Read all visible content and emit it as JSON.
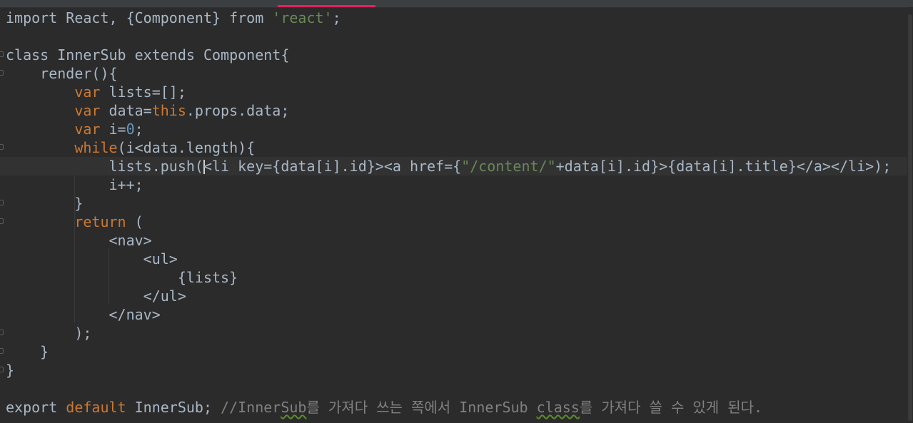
{
  "editor": {
    "language": "javascript-jsx",
    "colors": {
      "background": "#2b2b2b",
      "default_text": "#a9b7c6",
      "keyword": "#cc7832",
      "string": "#6a8759",
      "number": "#6897bb",
      "comment": "#808080",
      "active_tab_indicator": "#e0245e",
      "current_line": "#323232"
    },
    "lines": [
      {
        "tokens": [
          [
            "t",
            "import React, {Component} from "
          ],
          [
            "str",
            "'react'"
          ],
          [
            "t",
            ";"
          ]
        ]
      },
      {
        "tokens": []
      },
      {
        "tokens": [
          [
            "t",
            "class InnerSub extends Component{"
          ]
        ]
      },
      {
        "tokens": [
          [
            "t",
            "    render(){"
          ]
        ]
      },
      {
        "tokens": [
          [
            "t",
            "        "
          ],
          [
            "kw",
            "var"
          ],
          [
            "t",
            " lists=[];"
          ]
        ]
      },
      {
        "tokens": [
          [
            "t",
            "        "
          ],
          [
            "kw",
            "var"
          ],
          [
            "t",
            " data="
          ],
          [
            "kw",
            "this"
          ],
          [
            "t",
            ".props.data;"
          ]
        ]
      },
      {
        "tokens": [
          [
            "t",
            "        "
          ],
          [
            "kw",
            "var"
          ],
          [
            "t",
            " i="
          ],
          [
            "num",
            "0"
          ],
          [
            "t",
            ";"
          ]
        ]
      },
      {
        "tokens": [
          [
            "t",
            "        "
          ],
          [
            "kw",
            "while"
          ],
          [
            "t",
            "(i<data.length){"
          ]
        ]
      },
      {
        "tokens": [
          [
            "t",
            "            lists.push("
          ],
          [
            "caret",
            ""
          ],
          [
            "t",
            "<li key={data[i].id}><a href={"
          ],
          [
            "str",
            "\"/content/\""
          ],
          [
            "t",
            "+data[i].id}>{data[i].title}</a></li>);"
          ]
        ]
      },
      {
        "tokens": [
          [
            "t",
            "            i++;"
          ]
        ]
      },
      {
        "tokens": [
          [
            "t",
            "        }"
          ]
        ]
      },
      {
        "tokens": [
          [
            "t",
            "        "
          ],
          [
            "kw",
            "return"
          ],
          [
            "t",
            " ("
          ]
        ]
      },
      {
        "tokens": [
          [
            "t",
            "            <nav>"
          ]
        ]
      },
      {
        "tokens": [
          [
            "t",
            "                <ul>"
          ]
        ]
      },
      {
        "tokens": [
          [
            "t",
            "                    {lists}"
          ]
        ]
      },
      {
        "tokens": [
          [
            "t",
            "                </ul>"
          ]
        ]
      },
      {
        "tokens": [
          [
            "t",
            "            </nav>"
          ]
        ]
      },
      {
        "tokens": [
          [
            "t",
            "        );"
          ]
        ]
      },
      {
        "tokens": [
          [
            "t",
            "    }"
          ]
        ]
      },
      {
        "tokens": [
          [
            "t",
            "}"
          ]
        ]
      },
      {
        "tokens": []
      },
      {
        "tokens": [
          [
            "t",
            "export "
          ],
          [
            "kw",
            "default"
          ],
          [
            "t",
            " InnerSub; "
          ],
          [
            "cm",
            "//Inner"
          ],
          [
            "cmsq",
            "Sub"
          ],
          [
            "cm",
            "를 가져다 쓰는 쪽에서 InnerSub "
          ],
          [
            "cmsq",
            "class"
          ],
          [
            "cm",
            "를 가져다 쓸 수 있게 된다."
          ]
        ]
      }
    ],
    "current_line_index": 8,
    "fold_marker_lines": [
      2,
      3,
      7,
      10,
      11,
      17,
      18,
      19
    ]
  }
}
